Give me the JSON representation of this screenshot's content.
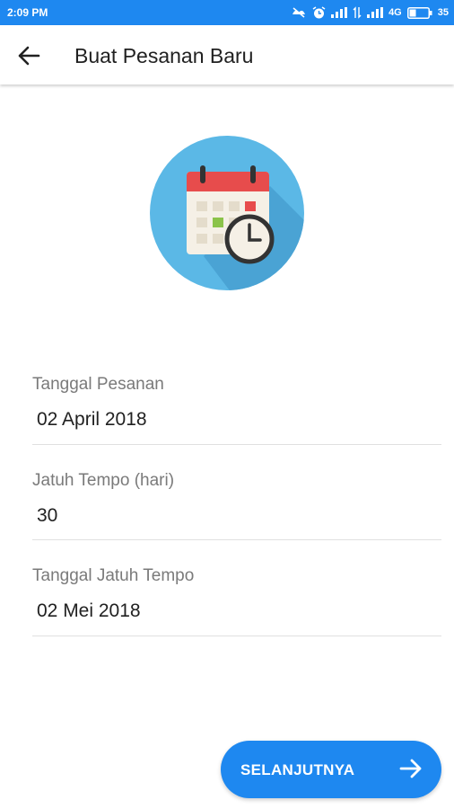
{
  "status_bar": {
    "time": "2:09 PM",
    "network": "4G",
    "battery": "35"
  },
  "app_bar": {
    "back_icon": "arrow-left-icon",
    "title": "Buat Pesanan Baru"
  },
  "hero": {
    "icon": "calendar-clock-icon"
  },
  "form": {
    "order_date": {
      "label": "Tanggal Pesanan",
      "value": "02 April 2018"
    },
    "due_days": {
      "label": "Jatuh Tempo (hari)",
      "value": "30"
    },
    "due_date": {
      "label": "Tanggal Jatuh Tempo",
      "value": "02 Mei 2018"
    }
  },
  "next_button": {
    "label": "SELANJUTNYA",
    "icon": "arrow-right-icon"
  },
  "colors": {
    "primary": "#1e88f0",
    "hero_circle": "#5bb8e6",
    "calendar_header": "#e74c4c",
    "accent_green": "#8bc34a"
  }
}
